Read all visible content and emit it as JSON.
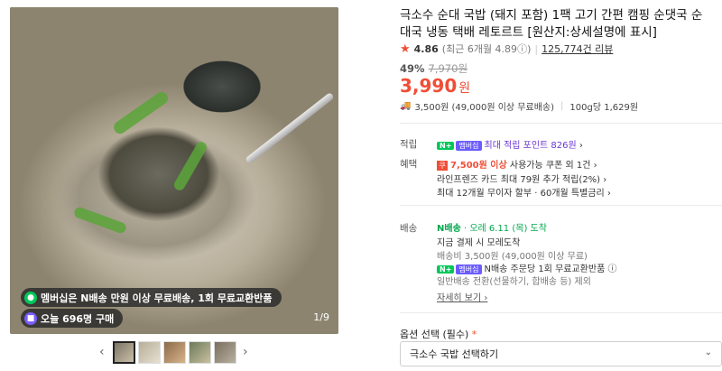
{
  "gallery": {
    "badge1": "멤버십은 N배송 만원 이상 무료배송, 1회 무료교환반품",
    "badge2": "오늘 696명 구매",
    "counter": "1/9",
    "prev": "‹",
    "next": "›"
  },
  "product": {
    "title": "극소수 순대 국밥 (돼지 포함) 1팩 고기 간편 캠핑 순댓국 순대국 냉동 택배 레토르트 [원산지:상세설명에 표시]",
    "rating": "4.86",
    "rating_recent": "(최근 6개월 4.89",
    "info_icon": "ⓘ",
    "rating_recent_close": ")",
    "reviews": "125,774건 리뷰",
    "discount_rate": "49%",
    "original_price": "7,970원",
    "price": "3,990",
    "price_unit": "원",
    "shipping_line": "3,500원 (49,000원 이상 무료배송)",
    "unit_price": "100g당 1,629원"
  },
  "rows": {
    "point_label": "적립",
    "point_badge": "N+",
    "point_badge2": "멤버십",
    "point_text": "최대 적립 포인트 826원",
    "point_chevron": "›",
    "benefit_label": "혜택",
    "benefit1_icon": "쿠",
    "benefit1_amount": "7,500원 이상",
    "benefit1_rest": " 사용가능 쿠폰 외 1건",
    "benefit2": "라인프렌즈 카드 최대 79원 추가 적립(2%)",
    "benefit3": "최대 12개월 무이자 할부 · 60개월 특별금리",
    "delivery_label": "배송",
    "delivery_n": "N배송",
    "delivery_arrival": " · 오레 6.11 (목) 도착",
    "delivery_line2": "지금 결제 시 모레도착",
    "delivery_line3": "배송비 3,500원 (49,000원 이상 무료)",
    "delivery_line4": "N배송 주문당 1회 무료교환반품",
    "delivery_line5": "일반배송 전환(선물하기, 합배송 등) 제외",
    "delivery_more": "자세히 보기"
  },
  "option": {
    "label": "옵션 선택 (필수)",
    "required_mark": "*",
    "selected": "극소수 국밥 선택하기",
    "chevron": "⌄"
  },
  "colors": {
    "accent": "#f04e37",
    "npay_green": "#03c75a",
    "purple": "#6b37d4"
  }
}
